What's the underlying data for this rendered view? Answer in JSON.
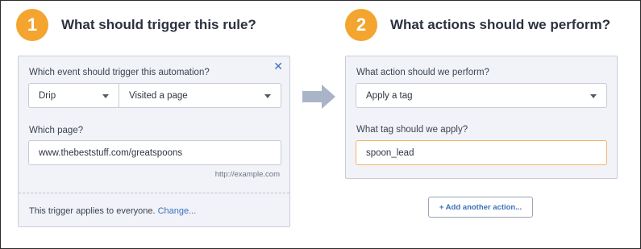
{
  "steps": [
    {
      "number": "1",
      "title": "What should trigger this rule?"
    },
    {
      "number": "2",
      "title": "What actions should we perform?"
    }
  ],
  "trigger": {
    "event_label": "Which event should trigger this automation?",
    "close_icon": "close-icon",
    "provider_value": "Drip",
    "event_value": "Visited a page",
    "page_label": "Which page?",
    "page_value": "www.thebeststuff.com/greatspoons",
    "page_hint": "http://example.com",
    "footer_text": "This trigger applies to everyone.",
    "footer_link": "Change..."
  },
  "action": {
    "action_label": "What action should we perform?",
    "action_value": "Apply a tag",
    "tag_label": "What tag should we apply?",
    "tag_value": "spoon_lead"
  },
  "add_action_button": "+ Add another action...",
  "colors": {
    "badge": "#f3a52f",
    "panel_bg": "#f1f3f8",
    "link": "#3a72b8",
    "arrow": "#a9b4c8",
    "focus_border": "#f0b46a"
  }
}
